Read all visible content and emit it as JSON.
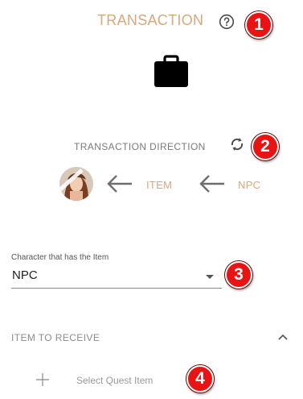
{
  "header": {
    "title": "TRANSACTION",
    "help_icon": "question-circle-icon",
    "icon": "briefcase-icon"
  },
  "direction": {
    "label": "TRANSACTION DIRECTION",
    "swap_icon": "swap-arrows-icon",
    "flow": [
      {
        "kind": "avatar"
      },
      {
        "kind": "arrow",
        "icon": "arrow-left-icon"
      },
      {
        "kind": "text",
        "label": "ITEM"
      },
      {
        "kind": "arrow",
        "icon": "arrow-left-icon"
      },
      {
        "kind": "text",
        "label": "NPC"
      }
    ]
  },
  "holder_field": {
    "label": "Character that has the Item",
    "value": "NPC"
  },
  "item_section": {
    "header": "ITEM TO RECEIVE",
    "toggle_icon": "chevron-up-icon",
    "add_label": "Select Quest Item",
    "add_icon": "plus-icon"
  },
  "callouts": [
    "1",
    "2",
    "3",
    "4"
  ],
  "colors": {
    "accent": "#d6a97c",
    "callout_red": "#e81313",
    "muted_text": "#8c8c8c"
  }
}
